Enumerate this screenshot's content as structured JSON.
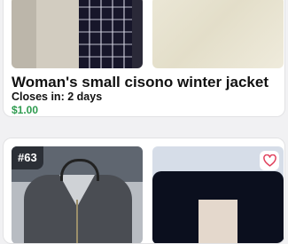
{
  "listings": [
    {
      "title": "Woman's small cisono winter jacket",
      "closes_label": "Closes in:",
      "closes_value": "2 days",
      "price": "$1.00"
    },
    {
      "badge": "#63",
      "favorite_icon": "heart-outline-icon"
    }
  ],
  "colors": {
    "price": "#2e9b4f",
    "favorite_icon": "#e0405c",
    "badge_bg": "#2b2f36"
  }
}
